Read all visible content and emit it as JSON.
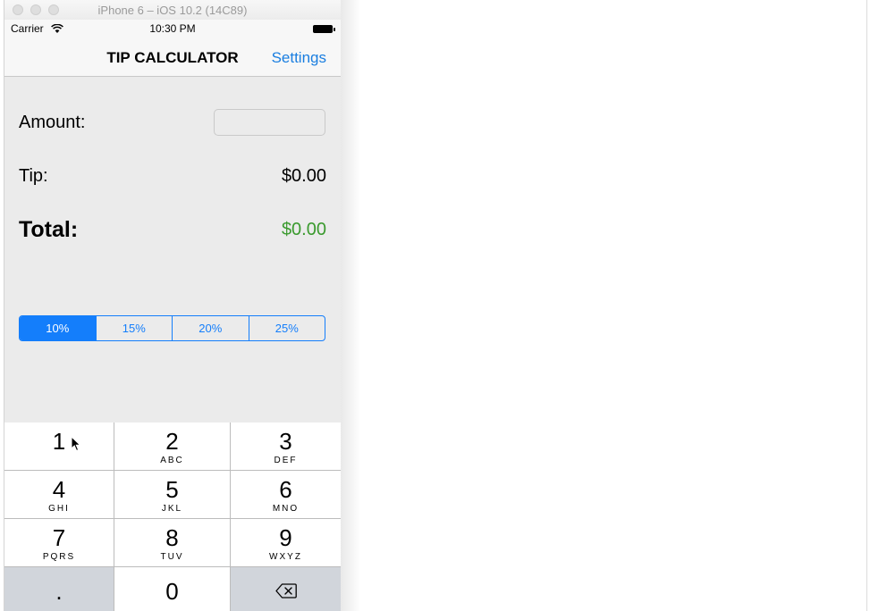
{
  "simulator": {
    "window_title": "iPhone 6 – iOS 10.2 (14C89)"
  },
  "status_bar": {
    "carrier": "Carrier",
    "time": "10:30 PM"
  },
  "nav": {
    "title": "TIP CALCULATOR",
    "settings_label": "Settings"
  },
  "form": {
    "amount_label": "Amount:",
    "amount_value": "",
    "tip_label": "Tip:",
    "tip_value": "$0.00",
    "total_label": "Total:",
    "total_value": "$0.00"
  },
  "tip_options": {
    "items": [
      "10%",
      "15%",
      "20%",
      "25%"
    ],
    "selected_index": 0
  },
  "keypad": {
    "keys": [
      {
        "num": "1",
        "letters": ""
      },
      {
        "num": "2",
        "letters": "ABC"
      },
      {
        "num": "3",
        "letters": "DEF"
      },
      {
        "num": "4",
        "letters": "GHI"
      },
      {
        "num": "5",
        "letters": "JKL"
      },
      {
        "num": "6",
        "letters": "MNO"
      },
      {
        "num": "7",
        "letters": "PQRS"
      },
      {
        "num": "8",
        "letters": "TUV"
      },
      {
        "num": "9",
        "letters": "WXYZ"
      }
    ],
    "decimal": ".",
    "zero": "0"
  },
  "colors": {
    "accent": "#147efb",
    "total_green": "#3a9a2e",
    "background": "#ebebeb"
  }
}
